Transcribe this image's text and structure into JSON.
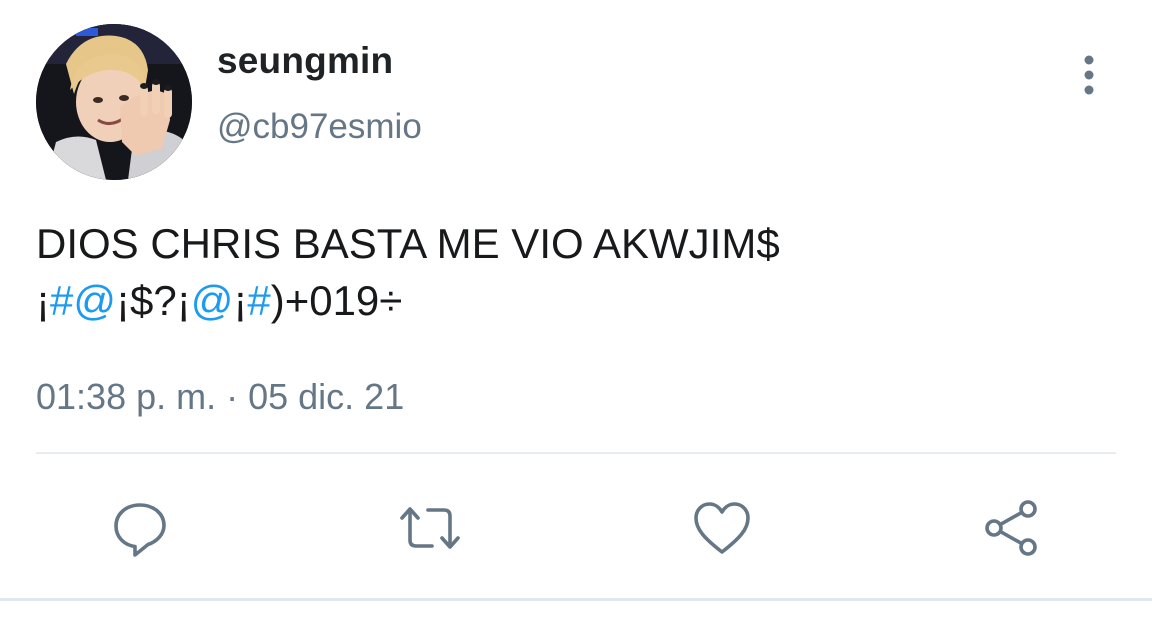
{
  "user": {
    "display_name": "seungmin",
    "handle": "@cb97esmio"
  },
  "tweet": {
    "line1": "DIOS CHRIS BASTA ME VIO AKWJIM$",
    "line2_segments": [
      "¡",
      "#",
      "@",
      "¡$?¡",
      "@",
      "¡",
      "#",
      ")+019÷"
    ],
    "timestamp": "01:38 p. m. · 05 dic. 21"
  },
  "icons": {
    "more": "more-vertical-icon",
    "reply": "reply-icon",
    "retweet": "retweet-icon",
    "like": "heart-icon",
    "share": "share-icon"
  },
  "colors": {
    "link": "#1d9bf0",
    "secondary_text": "#657786",
    "divider": "#e6ecf0"
  }
}
